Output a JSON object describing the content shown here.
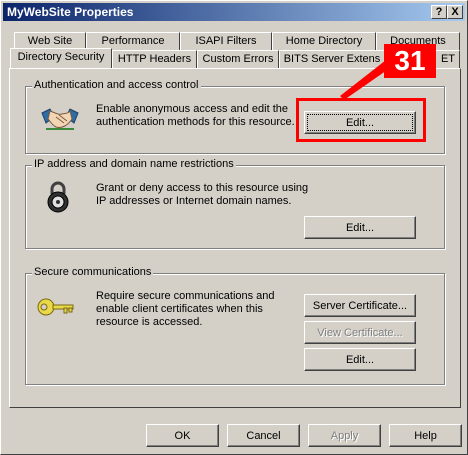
{
  "window": {
    "title": "MyWebSite Properties"
  },
  "titlebar_buttons": {
    "help": "?",
    "close": "X"
  },
  "tabs_row1": [
    "Web Site",
    "Performance",
    "ISAPI Filters",
    "Home Directory",
    "Documents"
  ],
  "tabs_row2": [
    "Directory Security",
    "HTTP Headers",
    "Custom Errors",
    "BITS Server Extensions",
    "ASP.NET"
  ],
  "tabs_row2_display": [
    "Directory Security",
    "HTTP Headers",
    "Custom Errors",
    "BITS Server Extens",
    "ET"
  ],
  "active_tab": "Directory Security",
  "auth": {
    "label": "Authentication and access control",
    "description_line1": "Enable anonymous access and edit the",
    "description_line2": "authentication methods for this resource.",
    "edit_label": "Edit..."
  },
  "ip": {
    "label": "IP address and domain name restrictions",
    "description_line1": "Grant or deny access to this resource using",
    "description_line2": "IP addresses or Internet domain names.",
    "edit_label": "Edit..."
  },
  "secure": {
    "label": "Secure communications",
    "description_line1": "Require secure communications and",
    "description_line2": "enable client certificates when this",
    "description_line3": "resource is accessed.",
    "server_cert_label": "Server Certificate...",
    "view_cert_label": "View Certificate...",
    "edit_label": "Edit..."
  },
  "footer": {
    "ok": "OK",
    "cancel": "Cancel",
    "apply": "Apply",
    "help": "Help"
  },
  "annotation": {
    "number": "31",
    "color": "#ff0000"
  }
}
